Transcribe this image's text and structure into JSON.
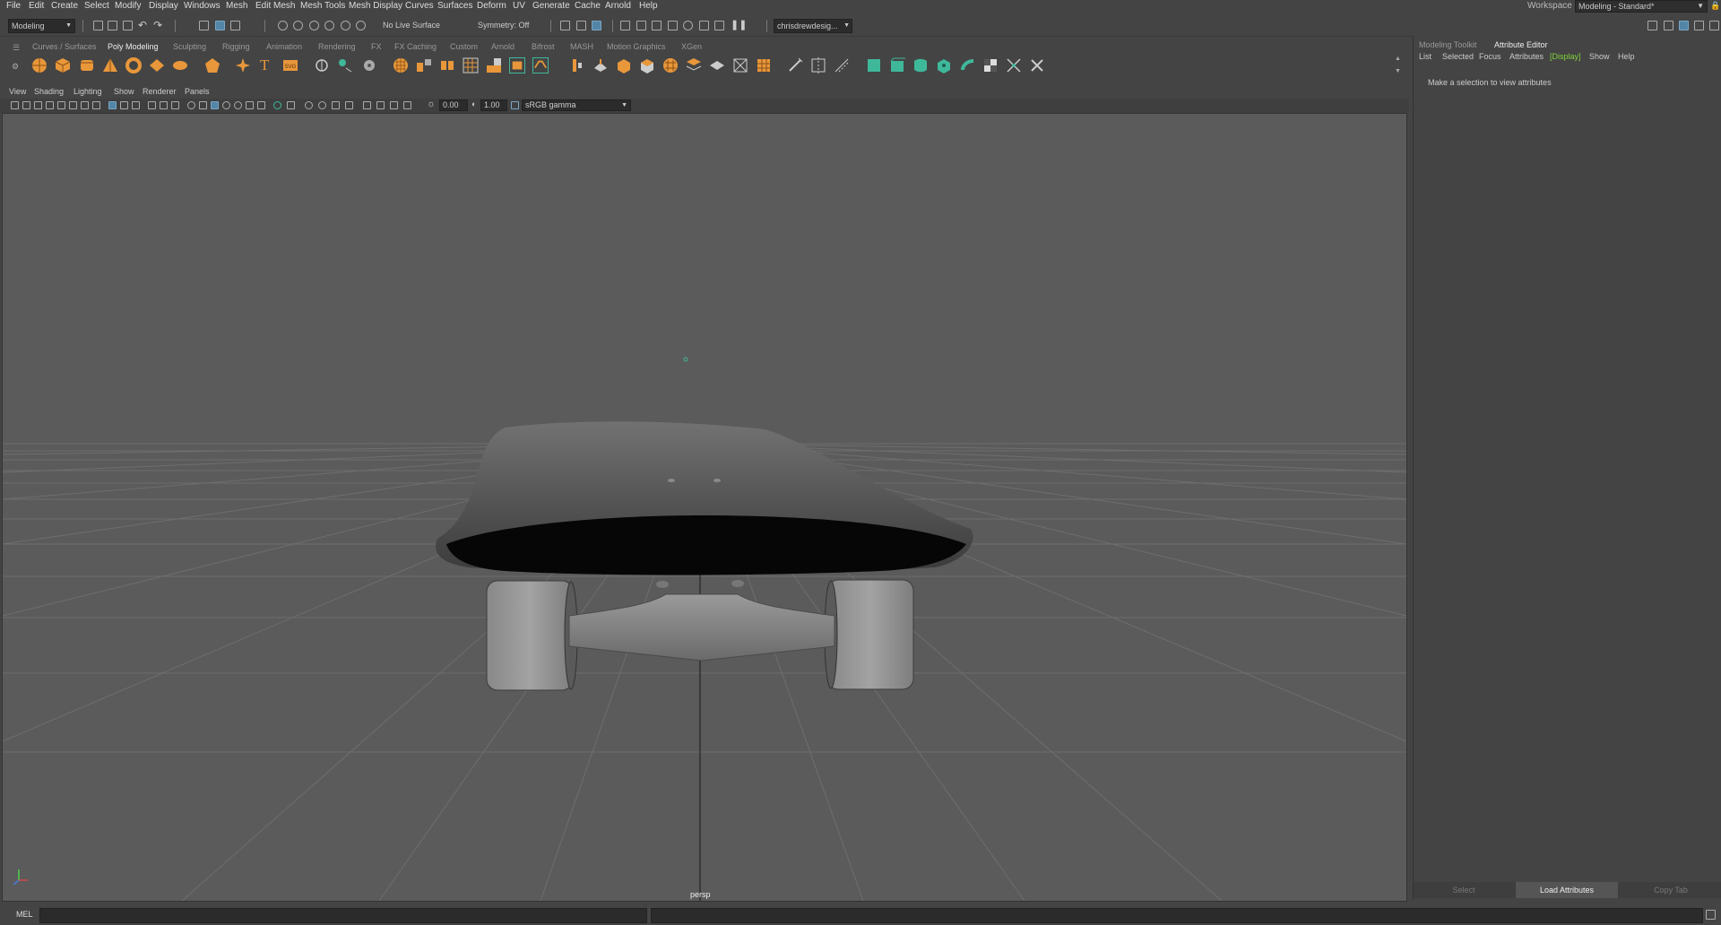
{
  "menubar": {
    "items": [
      "File",
      "Edit",
      "Create",
      "Select",
      "Modify",
      "Display",
      "Windows",
      "Mesh",
      "Edit Mesh",
      "Mesh Tools",
      "Mesh Display",
      "Curves",
      "Surfaces",
      "Deform",
      "UV",
      "Generate",
      "Cache",
      "Arnold",
      "Help"
    ],
    "workspace_label": "Workspace :",
    "workspace_value": "Modeling - Standard*"
  },
  "statusline": {
    "menuset": "Modeling",
    "live_surface": "No Live Surface",
    "symmetry": "Symmetry: Off",
    "user": "chrisdrewdesig..."
  },
  "shelf": {
    "tabs": [
      "Curves / Surfaces",
      "Poly Modeling",
      "Sculpting",
      "Rigging",
      "Animation",
      "Rendering",
      "FX",
      "FX Caching",
      "Custom",
      "Arnold",
      "Bifrost",
      "MASH",
      "Motion Graphics",
      "XGen"
    ],
    "active_tab": "Poly Modeling"
  },
  "panel": {
    "menus": [
      "View",
      "Shading",
      "Lighting",
      "Show",
      "Renderer",
      "Panels"
    ],
    "exposure": "0.00",
    "gamma": "1.00",
    "color_space": "sRGB gamma",
    "camera_label": "persp"
  },
  "right_panel": {
    "tabs": [
      "Modeling Toolkit",
      "Attribute Editor"
    ],
    "active_tab": "Attribute Editor",
    "menus": [
      "List",
      "Selected",
      "Focus",
      "Attributes",
      "[Display]",
      "Show",
      "Help"
    ],
    "message": "Make a selection to view attributes",
    "buttons": [
      "Select",
      "Load Attributes",
      "Copy Tab"
    ]
  },
  "command_line": {
    "language": "MEL"
  },
  "colors": {
    "accent_orange": "#e8973a",
    "accent_green": "#3fb89a",
    "display_highlight": "#7fd23a",
    "viewport_bg": "#5b5b5b"
  }
}
